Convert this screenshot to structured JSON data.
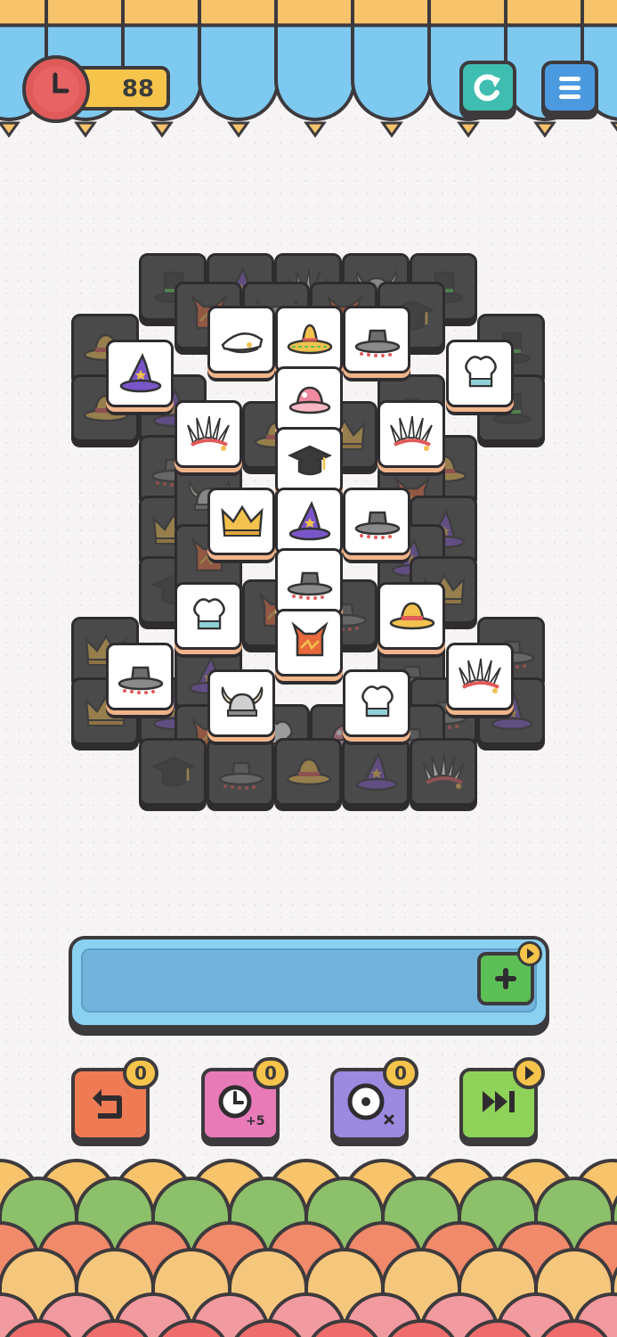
{
  "timer": {
    "value": "88",
    "icon": "clock-icon"
  },
  "header": {
    "restart_icon": "restart-icon",
    "menu_icon": "menu-icon"
  },
  "colors": {
    "board_dark": "#4b4a4b",
    "tile_white": "#ffffff",
    "tray_blue": "#72b3dc",
    "outline": "#3d3a3d"
  },
  "tray": {
    "add_icon": "plus-icon",
    "ad_icon": "play-icon"
  },
  "boosters": [
    {
      "id": "undo",
      "icon": "undo-icon",
      "count": "0",
      "color": "#ef7b55"
    },
    {
      "id": "add-time",
      "icon": "clock-plus-icon",
      "count": "0",
      "sub_label": "+5",
      "color": "#e87ab8"
    },
    {
      "id": "shuffle",
      "icon": "target-icon",
      "count": "0",
      "color": "#9b8ae0"
    },
    {
      "id": "skip",
      "icon": "skip-icon",
      "color": "#8fd25a",
      "badge_icon": "play-icon"
    }
  ],
  "tiles_open": [
    "captain-hat",
    "sombrero",
    "flat-hat",
    "wizard-hat",
    "chef-hat",
    "pink-bonnet",
    "feather-headdress",
    "feather-headdress",
    "graduation-cap",
    "crown",
    "wizard-hat",
    "flat-hat",
    "flat-hat",
    "chef-hat",
    "straw-hat",
    "devil-helmet",
    "flat-hat",
    "feather-headdress",
    "viking-helmet",
    "chef-hat"
  ]
}
